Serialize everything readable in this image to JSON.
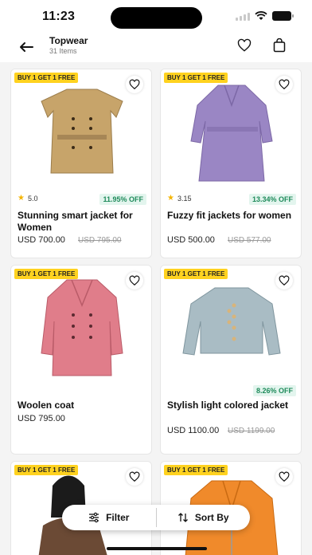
{
  "status": {
    "time": "11:23"
  },
  "header": {
    "title": "Topwear",
    "subtitle": "31 Items"
  },
  "products": [
    {
      "badge": "BUY 1 GET 1 FREE",
      "rating": "5.0",
      "discount": "11.95% OFF",
      "name": "Stunning smart jacket for Women",
      "price": "USD 700.00",
      "old_price": "USD 795.00",
      "color": "#c7a46a"
    },
    {
      "badge": "BUY 1 GET 1 FREE",
      "rating": "3.15",
      "discount": "13.34% OFF",
      "name": "Fuzzy fit jackets for women",
      "price": "USD 500.00",
      "old_price": "USD 577.00",
      "color": "#9a86c4"
    },
    {
      "badge": "BUY 1 GET 1 FREE",
      "rating": "",
      "discount": "",
      "name": "Woolen coat",
      "price": "USD 795.00",
      "old_price": "",
      "color": "#e07d8a"
    },
    {
      "badge": "BUY 1 GET 1 FREE",
      "rating": "",
      "discount": "8.26% OFF",
      "name": "Stylish light colored jacket",
      "price": "USD 1100.00",
      "old_price": "USD 1199.00",
      "color": "#a9bcc4"
    },
    {
      "badge": "BUY 1 GET 1 FREE",
      "rating": "",
      "discount": "",
      "name": "",
      "price": "",
      "old_price": "",
      "color": "#6b4a35"
    },
    {
      "badge": "BUY 1 GET 1 FREE",
      "rating": "",
      "discount": "",
      "name": "",
      "price": "",
      "old_price": "",
      "color": "#f08a2b"
    }
  ],
  "actions": {
    "filter_label": "Filter",
    "sort_label": "Sort By"
  },
  "icons": [
    "back-arrow-icon",
    "heart-icon",
    "bag-icon",
    "star-icon",
    "filter-icon",
    "sort-icon"
  ]
}
